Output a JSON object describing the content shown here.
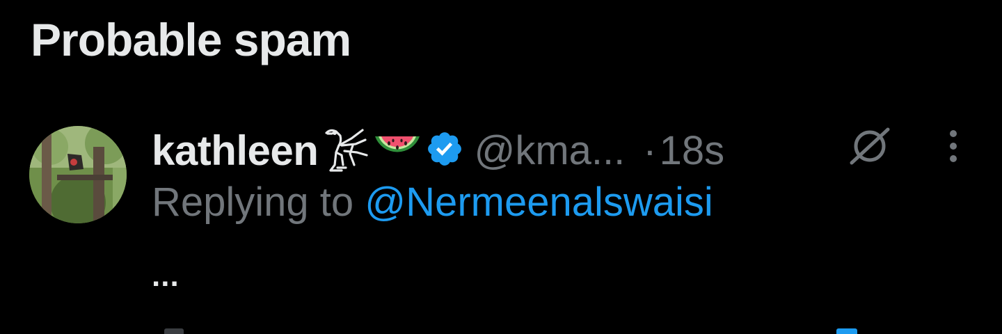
{
  "section": {
    "title": "Probable spam"
  },
  "tweet": {
    "display_name": "kathleen",
    "name_emojis": [
      "falcon-hieroglyph-icon",
      "watermelon-icon"
    ],
    "verified": true,
    "handle": "@kma...",
    "separator": "·",
    "time": "18s",
    "replying_label": "Replying to",
    "reply_mention": "@Nermeenalswaisi",
    "body": "..."
  },
  "colors": {
    "background": "#000000",
    "primary_text": "#e7e9ea",
    "secondary_text": "#71767b",
    "accent": "#1d9bf0"
  }
}
